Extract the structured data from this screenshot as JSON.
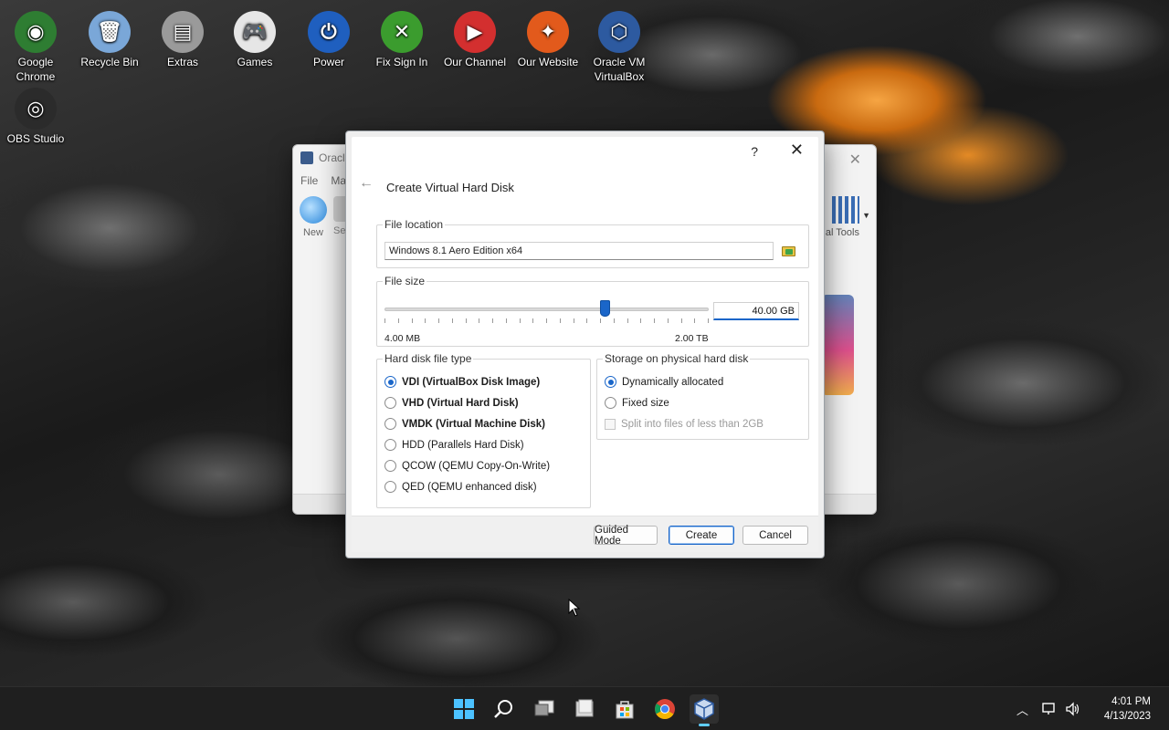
{
  "desktop": {
    "icons": [
      {
        "label": "Google Chrome",
        "icon": "chrome-icon",
        "color": "#2e7d32"
      },
      {
        "label": "Recycle Bin",
        "icon": "recycle-bin-icon",
        "color": "#7aa7d8"
      },
      {
        "label": "Extras",
        "icon": "folder-icon",
        "color": "#9a9a9a"
      },
      {
        "label": "Games",
        "icon": "gamepad-icon",
        "color": "#e6e6e6"
      },
      {
        "label": "Power",
        "icon": "power-icon",
        "color": "#1f5fbf"
      },
      {
        "label": "Fix Sign In",
        "icon": "xbox-icon",
        "color": "#3b9c2e"
      },
      {
        "label": "Our Channel",
        "icon": "youtube-icon",
        "color": "#d32f2f"
      },
      {
        "label": "Our Website",
        "icon": "phoenix-icon",
        "color": "#e25a1c"
      },
      {
        "label": "Oracle VM VirtualBox",
        "icon": "virtualbox-icon",
        "color": "#2d5aa0"
      },
      {
        "label": "OBS Studio",
        "icon": "obs-icon",
        "color": "#2b2b2b"
      }
    ]
  },
  "vbox_main": {
    "title": "Oracl",
    "menu": [
      "File",
      "Ma"
    ],
    "toolbar": {
      "new_label": "New",
      "settings_label": "Se",
      "tools_label": "al Tools"
    }
  },
  "dialog": {
    "help": "?",
    "close": "✕",
    "back": "←",
    "title": "Create Virtual Hard Disk",
    "file_location": {
      "label": "File location",
      "value": "Windows 8.1 Aero Edition x64"
    },
    "file_size": {
      "label": "File size",
      "value": "40.00 GB",
      "min_label": "4.00 MB",
      "max_label": "2.00 TB",
      "slider_fraction": 0.68
    },
    "disk_type": {
      "label": "Hard disk file type",
      "options": [
        {
          "label": "VDI (VirtualBox Disk Image)",
          "selected": true,
          "bold": true
        },
        {
          "label": "VHD (Virtual Hard Disk)",
          "selected": false,
          "bold": true
        },
        {
          "label": "VMDK (Virtual Machine Disk)",
          "selected": false,
          "bold": true
        },
        {
          "label": "HDD (Parallels Hard Disk)",
          "selected": false,
          "bold": false
        },
        {
          "label": "QCOW (QEMU Copy-On-Write)",
          "selected": false,
          "bold": false
        },
        {
          "label": "QED (QEMU enhanced disk)",
          "selected": false,
          "bold": false
        }
      ]
    },
    "storage": {
      "label": "Storage on physical hard disk",
      "options": [
        {
          "label": "Dynamically allocated",
          "selected": true
        },
        {
          "label": "Fixed size",
          "selected": false
        }
      ],
      "split_label": "Split into files of less than 2GB",
      "split_checked": false
    },
    "buttons": {
      "guided": "Guided Mode",
      "create": "Create",
      "cancel": "Cancel"
    }
  },
  "taskbar": {
    "items": [
      "start-icon",
      "search-icon",
      "task-view-icon",
      "file-explorer-icon",
      "store-icon",
      "chrome-icon",
      "virtualbox-icon"
    ],
    "active": "virtualbox-icon",
    "time": "4:01 PM",
    "date": "4/13/2023"
  }
}
